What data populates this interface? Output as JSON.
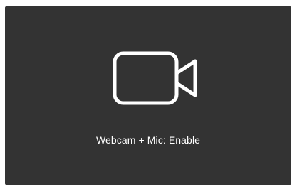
{
  "panel": {
    "background": "#333333",
    "icon": "video-camera-icon",
    "label": "Webcam + Mic: Enable",
    "text_color": "#ffffff"
  }
}
